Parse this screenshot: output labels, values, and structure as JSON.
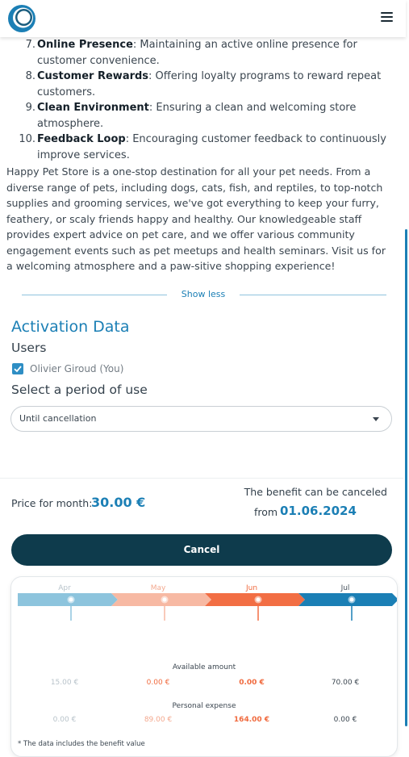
{
  "header": {
    "logo_icon": "circle-logo-icon",
    "menu_icon": "hamburger-menu-icon"
  },
  "features": [
    {
      "num": "7.",
      "title": "Online Presence",
      "text": ": Maintaining an active online presence for customer convenience."
    },
    {
      "num": "8.",
      "title": "Customer Rewards",
      "text": ": Offering loyalty programs to reward repeat customers."
    },
    {
      "num": "9.",
      "title": "Clean Environment",
      "text": ": Ensuring a clean and welcoming store atmosphere."
    },
    {
      "num": "10.",
      "title": "Feedback Loop",
      "text": ": Encouraging customer feedback to continuously improve services."
    }
  ],
  "description": "Happy Pet Store is a one-stop destination for all your pet needs. From a diverse range of pets, including dogs, cats, fish, and reptiles, to top-notch supplies and grooming services, we've got everything to keep your furry, feathery, or scaly friends happy and healthy. Our knowledgeable staff provides expert advice on pet care, and we offer various community engagement events such as pet meetups and health seminars. Visit us for a welcoming atmosphere and a paw-sitive shopping experience!",
  "show_less_label": "Show less",
  "activation": {
    "title": "Activation Data",
    "users_label": "Users",
    "user_name": "Olivier Giroud (You)",
    "user_checked": true,
    "period_label": "Select a period of use",
    "period_selected": "Until cancellation"
  },
  "price": {
    "label": "Price for month:",
    "value": "30.00 €",
    "benefit_text": "The benefit can be canceled",
    "from_label": "from",
    "from_date": "01.06.2024"
  },
  "cancel_button_label": "Cancel",
  "timeline": {
    "months": [
      {
        "label": "Apr",
        "color": "#b8c3ca",
        "segment_color": "#8dc4dd",
        "dot_fill": "#ffffff"
      },
      {
        "label": "May",
        "color": "#f3a88e",
        "segment_color": "#f7b9a3",
        "dot_fill": "#ffffff"
      },
      {
        "label": "Jun",
        "color": "#f06a3e",
        "segment_color": "#f26e44",
        "dot_fill": "#ffffff"
      },
      {
        "label": "Jul",
        "color": "#4a5560",
        "segment_color": "#1b7fb5",
        "dot_fill": "#ffffff"
      }
    ],
    "available_label": "Available amount",
    "available": [
      {
        "value": "15.00 €",
        "color": "#b8c3ca",
        "bold": false
      },
      {
        "value": "0.00 €",
        "color": "#f06a3e",
        "bold": false
      },
      {
        "value": "0.00 €",
        "color": "#f06a3e",
        "bold": true
      },
      {
        "value": "70.00 €",
        "color": "#3b4650",
        "bold": false
      }
    ],
    "expense_label": "Personal expense",
    "expense": [
      {
        "value": "0.00 €",
        "color": "#b8c3ca",
        "bold": false
      },
      {
        "value": "89.00 €",
        "color": "#f3a88e",
        "bold": false
      },
      {
        "value": "164.00 €",
        "color": "#f06a3e",
        "bold": true
      },
      {
        "value": "0.00 €",
        "color": "#3b4650",
        "bold": false
      }
    ],
    "footnote": "* The data includes the benefit value"
  },
  "colors": {
    "accent": "#1b7fb5",
    "button_bg": "#0e3b4c"
  }
}
